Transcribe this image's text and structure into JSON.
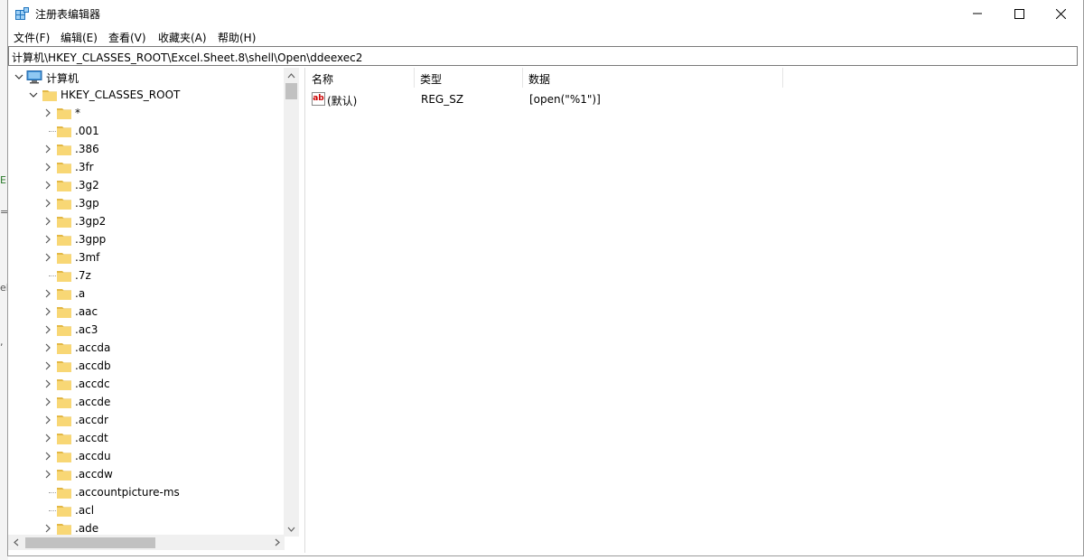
{
  "window": {
    "title": "注册表编辑器",
    "minimize_glyph": "—",
    "maximize_glyph": "☐",
    "close_glyph": "✕"
  },
  "background": {
    "glyphs": [
      "E",
      "=",
      "el",
      ","
    ]
  },
  "menu": {
    "items": [
      "文件(F)",
      "编辑(E)",
      "查看(V)",
      "收藏夹(A)",
      "帮助(H)"
    ]
  },
  "address": {
    "path": "计算机\\HKEY_CLASSES_ROOT\\Excel.Sheet.8\\shell\\Open\\ddeexec2"
  },
  "tree": {
    "root_label": "计算机",
    "hive_label": "HKEY_CLASSES_ROOT",
    "keys": [
      {
        "label": "*",
        "expandable": true
      },
      {
        "label": ".001",
        "expandable": false
      },
      {
        "label": ".386",
        "expandable": true
      },
      {
        "label": ".3fr",
        "expandable": true
      },
      {
        "label": ".3g2",
        "expandable": true
      },
      {
        "label": ".3gp",
        "expandable": true
      },
      {
        "label": ".3gp2",
        "expandable": true
      },
      {
        "label": ".3gpp",
        "expandable": true
      },
      {
        "label": ".3mf",
        "expandable": true
      },
      {
        "label": ".7z",
        "expandable": false
      },
      {
        "label": ".a",
        "expandable": true
      },
      {
        "label": ".aac",
        "expandable": true
      },
      {
        "label": ".ac3",
        "expandable": true
      },
      {
        "label": ".accda",
        "expandable": true
      },
      {
        "label": ".accdb",
        "expandable": true
      },
      {
        "label": ".accdc",
        "expandable": true
      },
      {
        "label": ".accde",
        "expandable": true
      },
      {
        "label": ".accdr",
        "expandable": true
      },
      {
        "label": ".accdt",
        "expandable": true
      },
      {
        "label": ".accdu",
        "expandable": true
      },
      {
        "label": ".accdw",
        "expandable": true
      },
      {
        "label": ".accountpicture-ms",
        "expandable": false
      },
      {
        "label": ".acl",
        "expandable": false
      },
      {
        "label": ".ade",
        "expandable": true
      }
    ]
  },
  "values": {
    "columns": [
      "名称",
      "类型",
      "数据"
    ],
    "rows": [
      {
        "icon": "string-value-icon",
        "icon_text": "ab",
        "name": "(默认)",
        "type": "REG_SZ",
        "data": "[open(\"%1\")]"
      }
    ]
  },
  "colors": {
    "folder": "#f8d775",
    "folder_dark": "#e3b845",
    "scroll_thumb": "#c1c1c1",
    "scroll_track": "#f0f0f0"
  }
}
